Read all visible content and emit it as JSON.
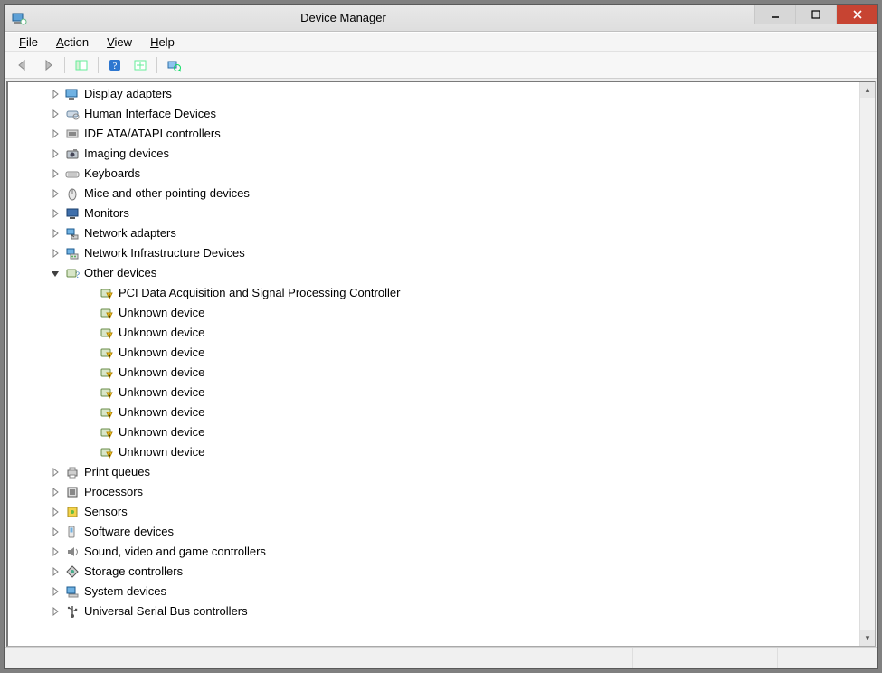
{
  "titlebar": {
    "title": "Device Manager"
  },
  "menu": {
    "file": "File",
    "action": "Action",
    "view": "View",
    "help": "Help"
  },
  "tree": {
    "nodes": [
      {
        "label": "Display adapters",
        "icon": "display",
        "expanded": false,
        "children": []
      },
      {
        "label": "Human Interface Devices",
        "icon": "hid",
        "expanded": false,
        "children": []
      },
      {
        "label": "IDE ATA/ATAPI controllers",
        "icon": "ide",
        "expanded": false,
        "children": []
      },
      {
        "label": "Imaging devices",
        "icon": "imaging",
        "expanded": false,
        "children": []
      },
      {
        "label": "Keyboards",
        "icon": "keyboard",
        "expanded": false,
        "children": []
      },
      {
        "label": "Mice and other pointing devices",
        "icon": "mouse",
        "expanded": false,
        "children": []
      },
      {
        "label": "Monitors",
        "icon": "monitor",
        "expanded": false,
        "children": []
      },
      {
        "label": "Network adapters",
        "icon": "network",
        "expanded": false,
        "children": []
      },
      {
        "label": "Network Infrastructure Devices",
        "icon": "netinfra",
        "expanded": false,
        "children": []
      },
      {
        "label": "Other devices",
        "icon": "other",
        "expanded": true,
        "children": [
          {
            "label": "PCI Data Acquisition and Signal Processing Controller",
            "icon": "warn"
          },
          {
            "label": "Unknown device",
            "icon": "warn"
          },
          {
            "label": "Unknown device",
            "icon": "warn"
          },
          {
            "label": "Unknown device",
            "icon": "warn"
          },
          {
            "label": "Unknown device",
            "icon": "warn"
          },
          {
            "label": "Unknown device",
            "icon": "warn"
          },
          {
            "label": "Unknown device",
            "icon": "warn"
          },
          {
            "label": "Unknown device",
            "icon": "warn"
          },
          {
            "label": "Unknown device",
            "icon": "warn"
          }
        ]
      },
      {
        "label": "Print queues",
        "icon": "printer",
        "expanded": false,
        "children": []
      },
      {
        "label": "Processors",
        "icon": "cpu",
        "expanded": false,
        "children": []
      },
      {
        "label": "Sensors",
        "icon": "sensor",
        "expanded": false,
        "children": []
      },
      {
        "label": "Software devices",
        "icon": "software",
        "expanded": false,
        "children": []
      },
      {
        "label": "Sound, video and game controllers",
        "icon": "sound",
        "expanded": false,
        "children": []
      },
      {
        "label": "Storage controllers",
        "icon": "storage",
        "expanded": false,
        "children": []
      },
      {
        "label": "System devices",
        "icon": "system",
        "expanded": false,
        "children": []
      },
      {
        "label": "Universal Serial Bus controllers",
        "icon": "usb",
        "expanded": false,
        "children": []
      }
    ]
  }
}
